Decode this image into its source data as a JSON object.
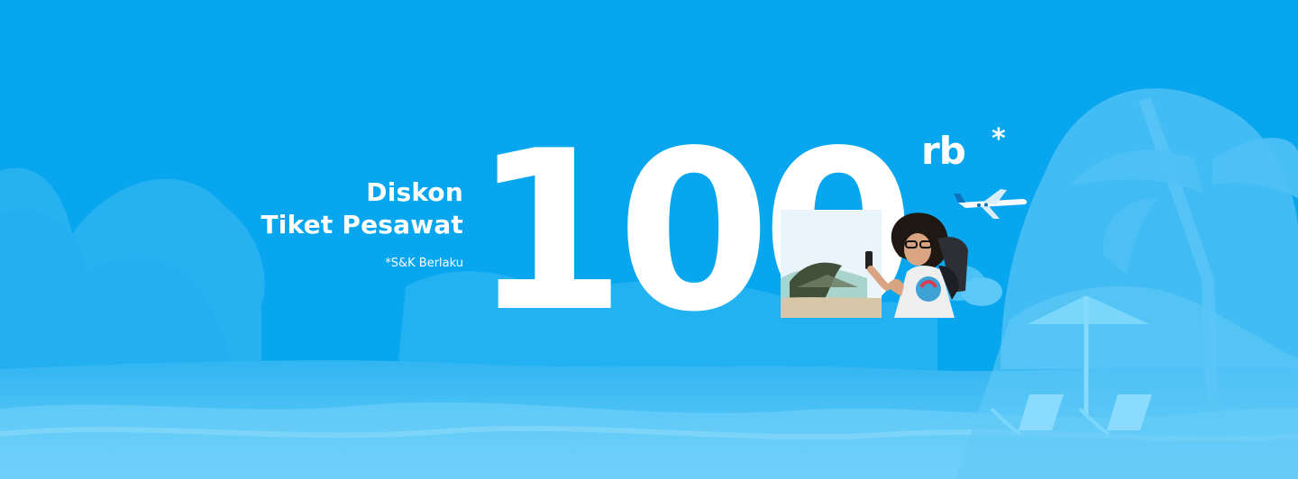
{
  "banner": {
    "title_line_1": "Diskon",
    "title_line_2": "Tiket Pesawat",
    "terms": "*S&K Berlaku",
    "amount": "100",
    "unit": "rb",
    "unit_asterisk": "*"
  },
  "colors": {
    "background": "#09a6ee",
    "foreground_text": "#ffffff",
    "light_scenery": "#5ec8f6",
    "dark_scenery": "#2fb3f0"
  }
}
